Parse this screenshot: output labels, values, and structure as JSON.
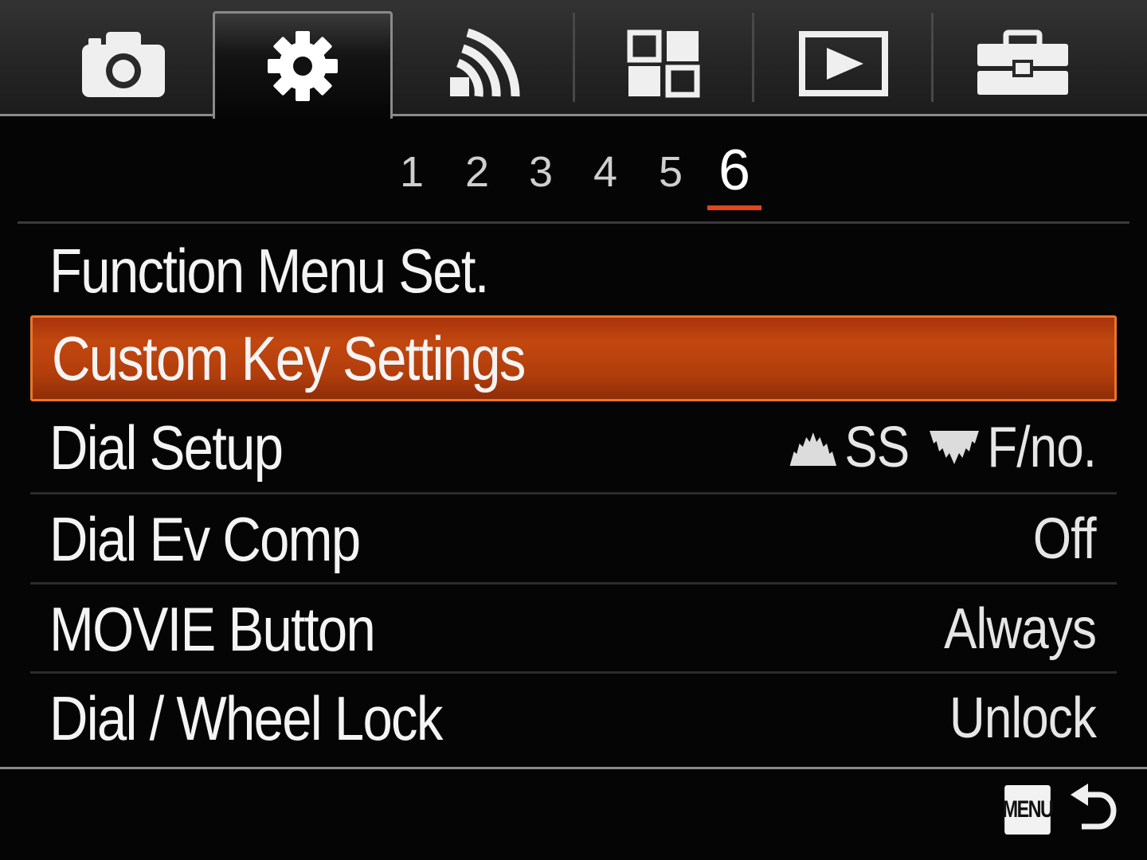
{
  "tabs": [
    {
      "icon": "camera-icon",
      "active": false
    },
    {
      "icon": "gear-icon",
      "active": true
    },
    {
      "icon": "wireless-icon",
      "active": false
    },
    {
      "icon": "applications-grid-icon",
      "active": false
    },
    {
      "icon": "playback-icon",
      "active": false
    },
    {
      "icon": "toolbox-icon",
      "active": false
    }
  ],
  "pages": {
    "numbers": [
      "1",
      "2",
      "3",
      "4",
      "5",
      "6"
    ],
    "current": "6"
  },
  "menu": {
    "items": [
      {
        "label": "Function Menu Set.",
        "value": ""
      },
      {
        "label": "Custom Key Settings",
        "value": "",
        "selected": true
      },
      {
        "label": "Dial Setup",
        "value": "",
        "front_dial": "SS",
        "rear_dial": "F/no."
      },
      {
        "label": "Dial Ev Comp",
        "value": "Off"
      },
      {
        "label": "MOVIE Button",
        "value": "Always"
      },
      {
        "label": "Dial / Wheel Lock",
        "value": "Unlock"
      }
    ]
  },
  "footer": {
    "menu_button": "MENU",
    "back_icon": "return-arrow-icon"
  },
  "colors": {
    "background": "#050505",
    "selection": "#c2470f",
    "selection_border": "#e8762a",
    "page_indicator": "#e0471a",
    "text": "#f4f4f4"
  }
}
